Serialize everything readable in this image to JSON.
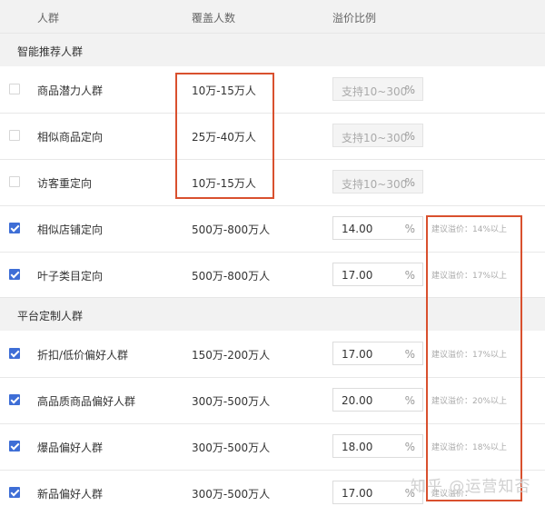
{
  "header": {
    "col_group": "人群",
    "col_coverage": "覆盖人数",
    "col_premium": "溢价比例"
  },
  "sections": [
    {
      "title": "智能推荐人群"
    },
    {
      "title": "平台定制人群"
    }
  ],
  "rows": [
    {
      "name": "商品潜力人群",
      "coverage": "10万-15万人",
      "checked": false,
      "disabled": true,
      "value": "支持10~300",
      "unit": "%",
      "suggestion": ""
    },
    {
      "name": "相似商品定向",
      "coverage": "25万-40万人",
      "checked": false,
      "disabled": true,
      "value": "支持10~300",
      "unit": "%",
      "suggestion": ""
    },
    {
      "name": "访客重定向",
      "coverage": "10万-15万人",
      "checked": false,
      "disabled": true,
      "value": "支持10~300",
      "unit": "%",
      "suggestion": ""
    },
    {
      "name": "相似店铺定向",
      "coverage": "500万-800万人",
      "checked": true,
      "disabled": false,
      "value": "14.00",
      "unit": "%",
      "suggestion": "建议溢价：14%以上"
    },
    {
      "name": "叶子类目定向",
      "coverage": "500万-800万人",
      "checked": true,
      "disabled": false,
      "value": "17.00",
      "unit": "%",
      "suggestion": "建议溢价：17%以上"
    },
    {
      "name": "折扣/低价偏好人群",
      "coverage": "150万-200万人",
      "checked": true,
      "disabled": false,
      "value": "17.00",
      "unit": "%",
      "suggestion": "建议溢价：17%以上"
    },
    {
      "name": "高品质商品偏好人群",
      "coverage": "300万-500万人",
      "checked": true,
      "disabled": false,
      "value": "20.00",
      "unit": "%",
      "suggestion": "建议溢价：20%以上"
    },
    {
      "name": "爆品偏好人群",
      "coverage": "300万-500万人",
      "checked": true,
      "disabled": false,
      "value": "18.00",
      "unit": "%",
      "suggestion": "建议溢价：18%以上"
    },
    {
      "name": "新品偏好人群",
      "coverage": "300万-500万人",
      "checked": true,
      "disabled": false,
      "value": "17.00",
      "unit": "%",
      "suggestion": "建议溢价："
    }
  ],
  "watermark": "知乎 @运营知否",
  "colors": {
    "accent": "#3e6ed6",
    "highlight": "#d9502e"
  }
}
